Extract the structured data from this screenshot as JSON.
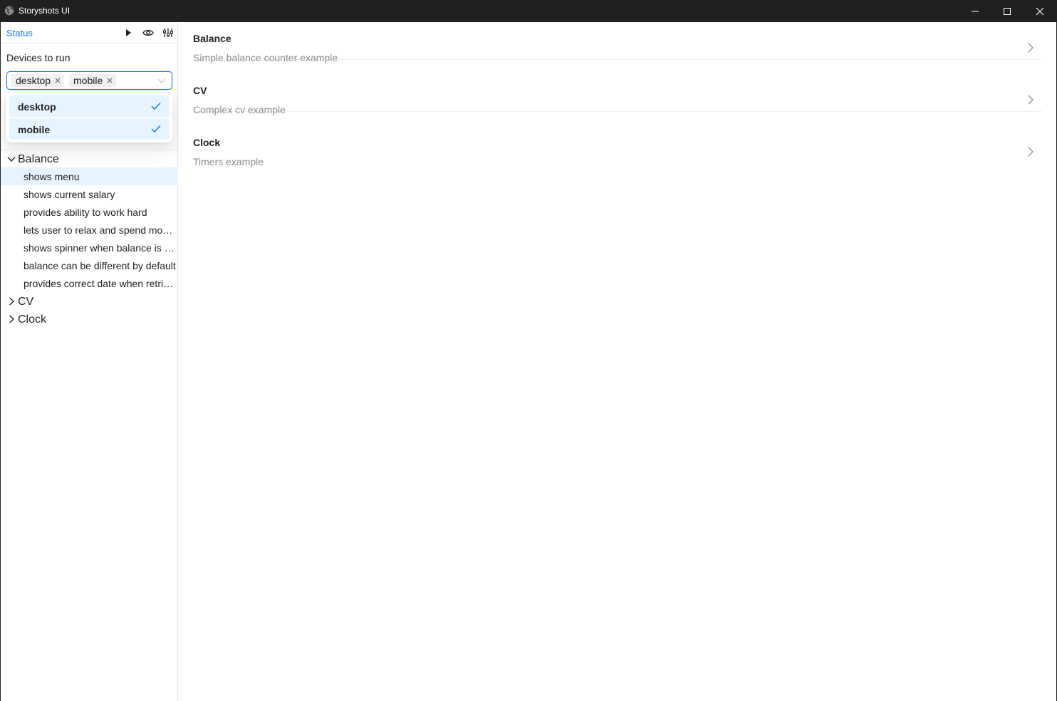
{
  "window": {
    "title": "Storyshots UI"
  },
  "sidebar": {
    "status_label": "Status",
    "devices_label": "Devices to run",
    "selected_devices": [
      "desktop",
      "mobile"
    ],
    "device_options": [
      {
        "label": "desktop",
        "checked": true
      },
      {
        "label": "mobile",
        "checked": true
      }
    ],
    "groups": [
      {
        "label": "Balance",
        "expanded": true,
        "items": [
          {
            "label": "shows menu",
            "selected": true
          },
          {
            "label": "shows current salary"
          },
          {
            "label": "provides ability to work hard"
          },
          {
            "label": "lets user to relax and spend money"
          },
          {
            "label": "shows spinner when balance is not loaded"
          },
          {
            "label": "balance can be different by default"
          },
          {
            "label": "provides correct date when retrieving salary"
          }
        ]
      },
      {
        "label": "CV",
        "expanded": false,
        "items": []
      },
      {
        "label": "Clock",
        "expanded": false,
        "items": []
      }
    ]
  },
  "main": {
    "stories": [
      {
        "title": "Balance",
        "description": "Simple balance counter example"
      },
      {
        "title": "CV",
        "description": "Complex cv example"
      },
      {
        "title": "Clock",
        "description": "Timers example"
      }
    ]
  },
  "colors": {
    "accent": "#1677ff",
    "selected_bg": "#e6f4ff",
    "titlebar": "#202020",
    "muted_text": "#8c8c8c"
  }
}
